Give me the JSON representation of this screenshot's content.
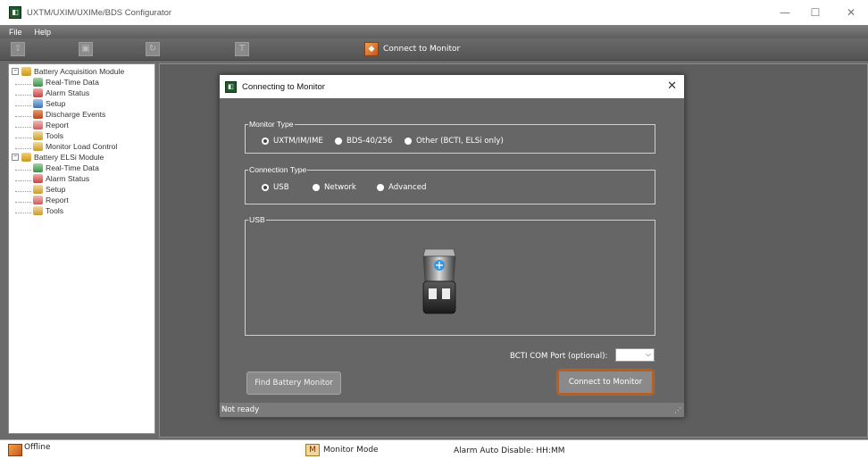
{
  "window": {
    "title": "UXTM/UXIM/UXIMe/BDS Configurator",
    "min": "—",
    "max": "☐",
    "close": "✕"
  },
  "menu": {
    "items": [
      "File",
      "Help"
    ]
  },
  "toolbar": {
    "connect_label": "Connect to Monitor"
  },
  "tree": {
    "items": [
      {
        "label": "Battery Acquisition Module",
        "level": 0,
        "expander": "−",
        "icon": "module-icon"
      },
      {
        "label": "Real-Time Data",
        "level": 1,
        "icon": "real-time-icon"
      },
      {
        "label": "Alarm Status",
        "level": 1,
        "icon": "alarm-icon"
      },
      {
        "label": "Setup",
        "level": 1,
        "icon": "setup-icon"
      },
      {
        "label": "Discharge Events",
        "level": 1,
        "icon": "discharge-icon"
      },
      {
        "label": "Report",
        "level": 1,
        "icon": "report-icon"
      },
      {
        "label": "Tools",
        "level": 1,
        "icon": "tools-icon"
      },
      {
        "label": "Monitor Load Control",
        "level": 1,
        "icon": "tools-icon"
      },
      {
        "label": "Battery ELSi Module",
        "level": 0,
        "expander": "−",
        "icon": "module-icon"
      },
      {
        "label": "Real-Time Data",
        "level": 1,
        "icon": "real-time-icon"
      },
      {
        "label": "Alarm Status",
        "level": 1,
        "icon": "alarm-icon"
      },
      {
        "label": "Setup",
        "level": 1,
        "icon": "tools-icon"
      },
      {
        "label": "Report",
        "level": 1,
        "icon": "report-icon"
      },
      {
        "label": "Tools",
        "level": 1,
        "icon": "tools-icon"
      }
    ]
  },
  "dialog": {
    "title": "Connecting to Monitor",
    "close": "✕",
    "monitor_type": {
      "legend": "Monitor Type",
      "options": [
        "UXTM/IM/IME",
        "BDS-40/256",
        "Other (BCTI, ELSi only)"
      ],
      "selected": 0
    },
    "connection_type": {
      "legend": "Connection Type",
      "options": [
        "USB",
        "Network",
        "Advanced"
      ],
      "selected": 0
    },
    "usb": {
      "legend": "USB"
    },
    "com_port": {
      "label": "BCTI COM Port (optional):",
      "value": ""
    },
    "find_button": "Find Battery Monitor",
    "connect_button": "Connect to Monitor",
    "status": "Not ready"
  },
  "statusbar": {
    "connection": "Offline",
    "mode": "Monitor Mode",
    "alarm": "Alarm Auto Disable: HH:MM"
  },
  "colors": {
    "accent": "#c05b1e",
    "panel": "#666666",
    "background": "#5e5e5e"
  }
}
